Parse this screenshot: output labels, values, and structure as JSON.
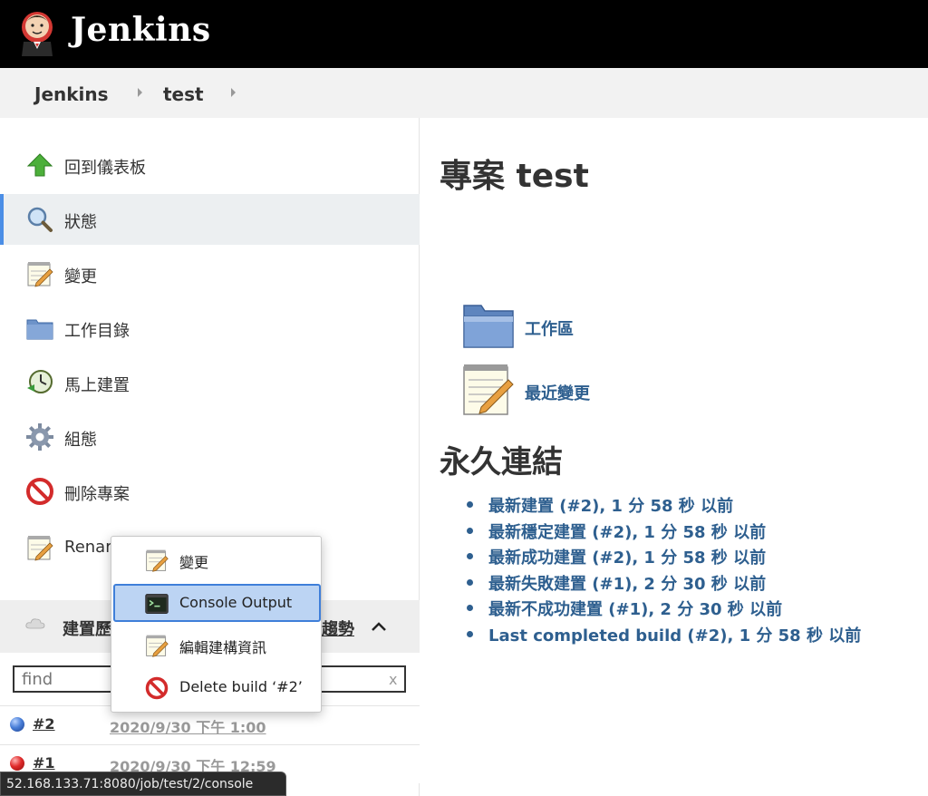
{
  "header": {
    "brand": "Jenkins"
  },
  "breadcrumb": {
    "items": [
      "Jenkins",
      "test"
    ]
  },
  "sidepanel": {
    "tasks": [
      {
        "label": "回到儀表板",
        "icon": "up-arrow-icon"
      },
      {
        "label": "狀態",
        "icon": "search-icon"
      },
      {
        "label": "變更",
        "icon": "notepad-icon"
      },
      {
        "label": "工作目錄",
        "icon": "folder-icon"
      },
      {
        "label": "馬上建置",
        "icon": "clock-icon"
      },
      {
        "label": "組態",
        "icon": "gear-icon"
      },
      {
        "label": "刪除專案",
        "icon": "no-entry-icon"
      },
      {
        "label": "Renar",
        "icon": "notepad-icon"
      }
    ]
  },
  "build_history": {
    "title": "建置歷",
    "trend": "趨勢",
    "search_placeholder": "find",
    "clear": "x",
    "builds": [
      {
        "number": "#2",
        "date": "2020/9/30 下午 1:00",
        "status": "blue"
      },
      {
        "number": "#1",
        "date": "2020/9/30 下午 12:59",
        "status": "red"
      }
    ]
  },
  "main": {
    "title": "專案 test",
    "links": [
      {
        "label": "工作區",
        "icon": "folder-icon"
      },
      {
        "label": "最近變更",
        "icon": "notepad-icon"
      }
    ],
    "permalinks_title": "永久連結",
    "permalinks": [
      "最新建置 (#2), 1 分 58 秒 以前",
      "最新穩定建置 (#2), 1 分 58 秒 以前",
      "最新成功建置 (#2), 1 分 58 秒 以前",
      "最新失敗建置 (#1), 2 分 30 秒 以前",
      "最新不成功建置 (#1), 2 分 30 秒 以前",
      "Last completed build (#2), 1 分 58 秒 以前"
    ]
  },
  "context_menu": {
    "items": [
      {
        "label": "變更",
        "icon": "notepad-icon"
      },
      {
        "label": "Console Output",
        "icon": "terminal-icon"
      },
      {
        "label": "編輯建構資訊",
        "icon": "notepad-icon"
      },
      {
        "label": "Delete build ‘#2’",
        "icon": "no-entry-icon"
      }
    ]
  },
  "statusbar": {
    "url": "52.168.133.71:8080/job/test/2/console"
  },
  "colors": {
    "link": "#2e5f8f",
    "header_bg": "#000000",
    "active_border": "#4b8ee6",
    "menu_highlight": "#bcd4f3"
  }
}
